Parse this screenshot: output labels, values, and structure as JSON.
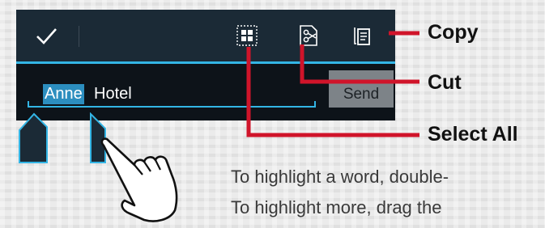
{
  "phone": {
    "selected_word": "Anne",
    "remaining_text": "Hotel",
    "send_label": "Send"
  },
  "action_bar": {
    "icons": [
      "done-icon",
      "select-all-icon",
      "cut-icon",
      "copy-icon"
    ]
  },
  "callouts": {
    "copy": "Copy",
    "cut": "Cut",
    "select_all": "Select All"
  },
  "instructions": {
    "line1": "To highlight a word, double-",
    "line2": "To highlight more, drag the"
  },
  "colors": {
    "accent": "#33b5e5",
    "callout_red": "#d0142a",
    "handle": "#1b2a36"
  }
}
